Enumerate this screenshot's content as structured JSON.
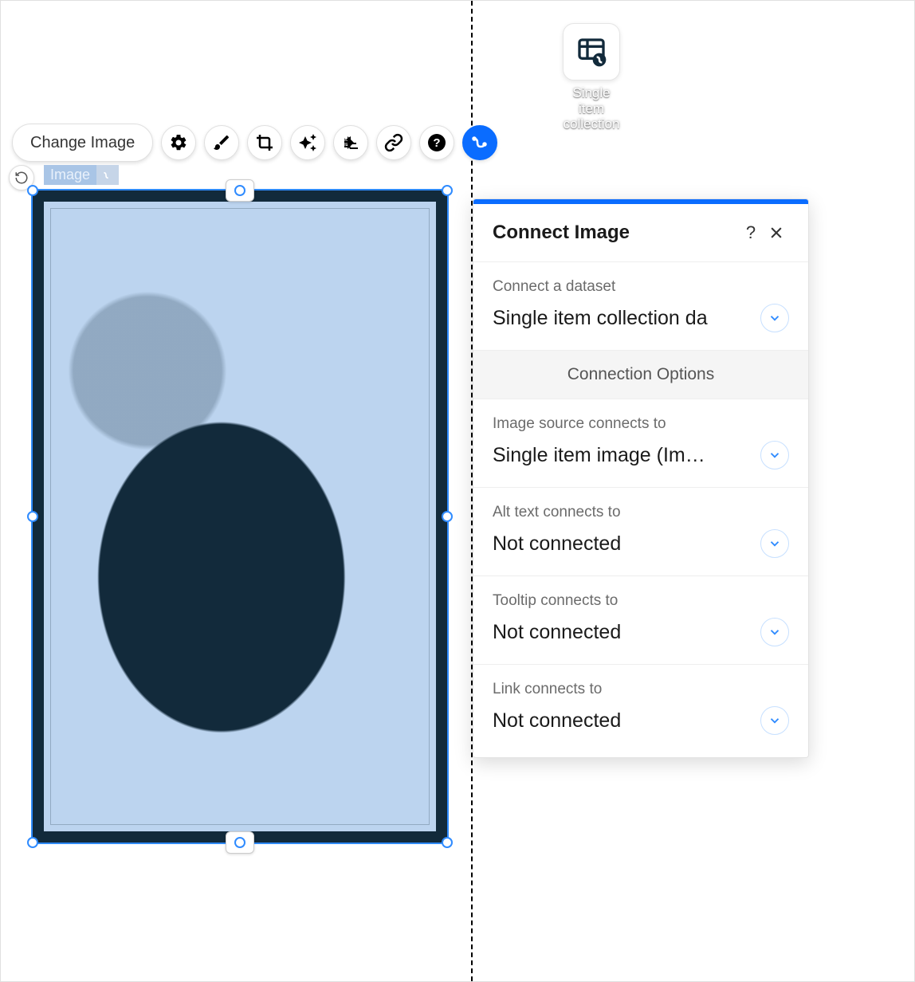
{
  "toolbar": {
    "change_image_label": "Change Image"
  },
  "element_label": "Image",
  "dataset_chip": {
    "label": "Single item collection"
  },
  "panel": {
    "title": "Connect Image",
    "dataset_label": "Connect a dataset",
    "dataset_value": "Single item collection da",
    "options_header": "Connection Options",
    "fields": [
      {
        "label": "Image source connects to",
        "value": "Single item image (Im…"
      },
      {
        "label": "Alt text connects to",
        "value": "Not connected"
      },
      {
        "label": "Tooltip connects to",
        "value": "Not connected"
      },
      {
        "label": "Link connects to",
        "value": "Not connected"
      }
    ]
  }
}
